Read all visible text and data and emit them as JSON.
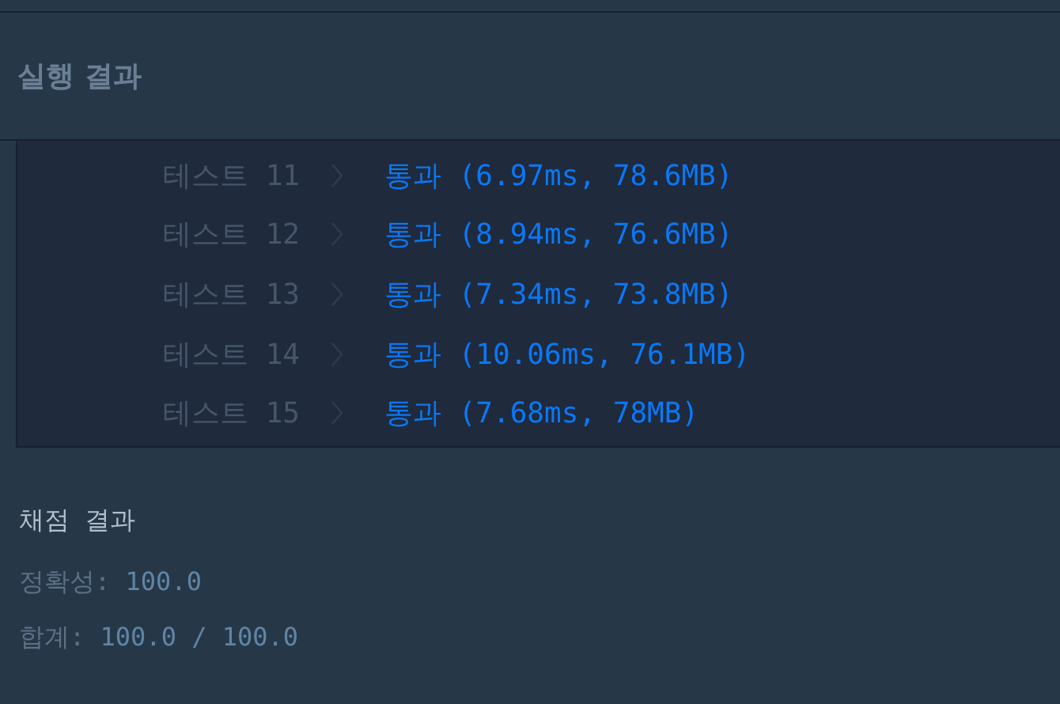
{
  "section_title": "실행 결과",
  "tests": [
    {
      "label": "테스트 11",
      "result": "통과 (6.97ms, 78.6MB)"
    },
    {
      "label": "테스트 12",
      "result": "통과 (8.94ms, 76.6MB)"
    },
    {
      "label": "테스트 13",
      "result": "통과 (7.34ms, 73.8MB)"
    },
    {
      "label": "테스트 14",
      "result": "통과 (10.06ms, 76.1MB)"
    },
    {
      "label": "테스트 15",
      "result": "통과 (7.68ms, 78MB)"
    }
  ],
  "grading": {
    "title": "채점 결과",
    "lines": [
      {
        "label": "정확성:",
        "value": "100.0"
      },
      {
        "label": "합계:",
        "value": "100.0 / 100.0"
      }
    ]
  }
}
